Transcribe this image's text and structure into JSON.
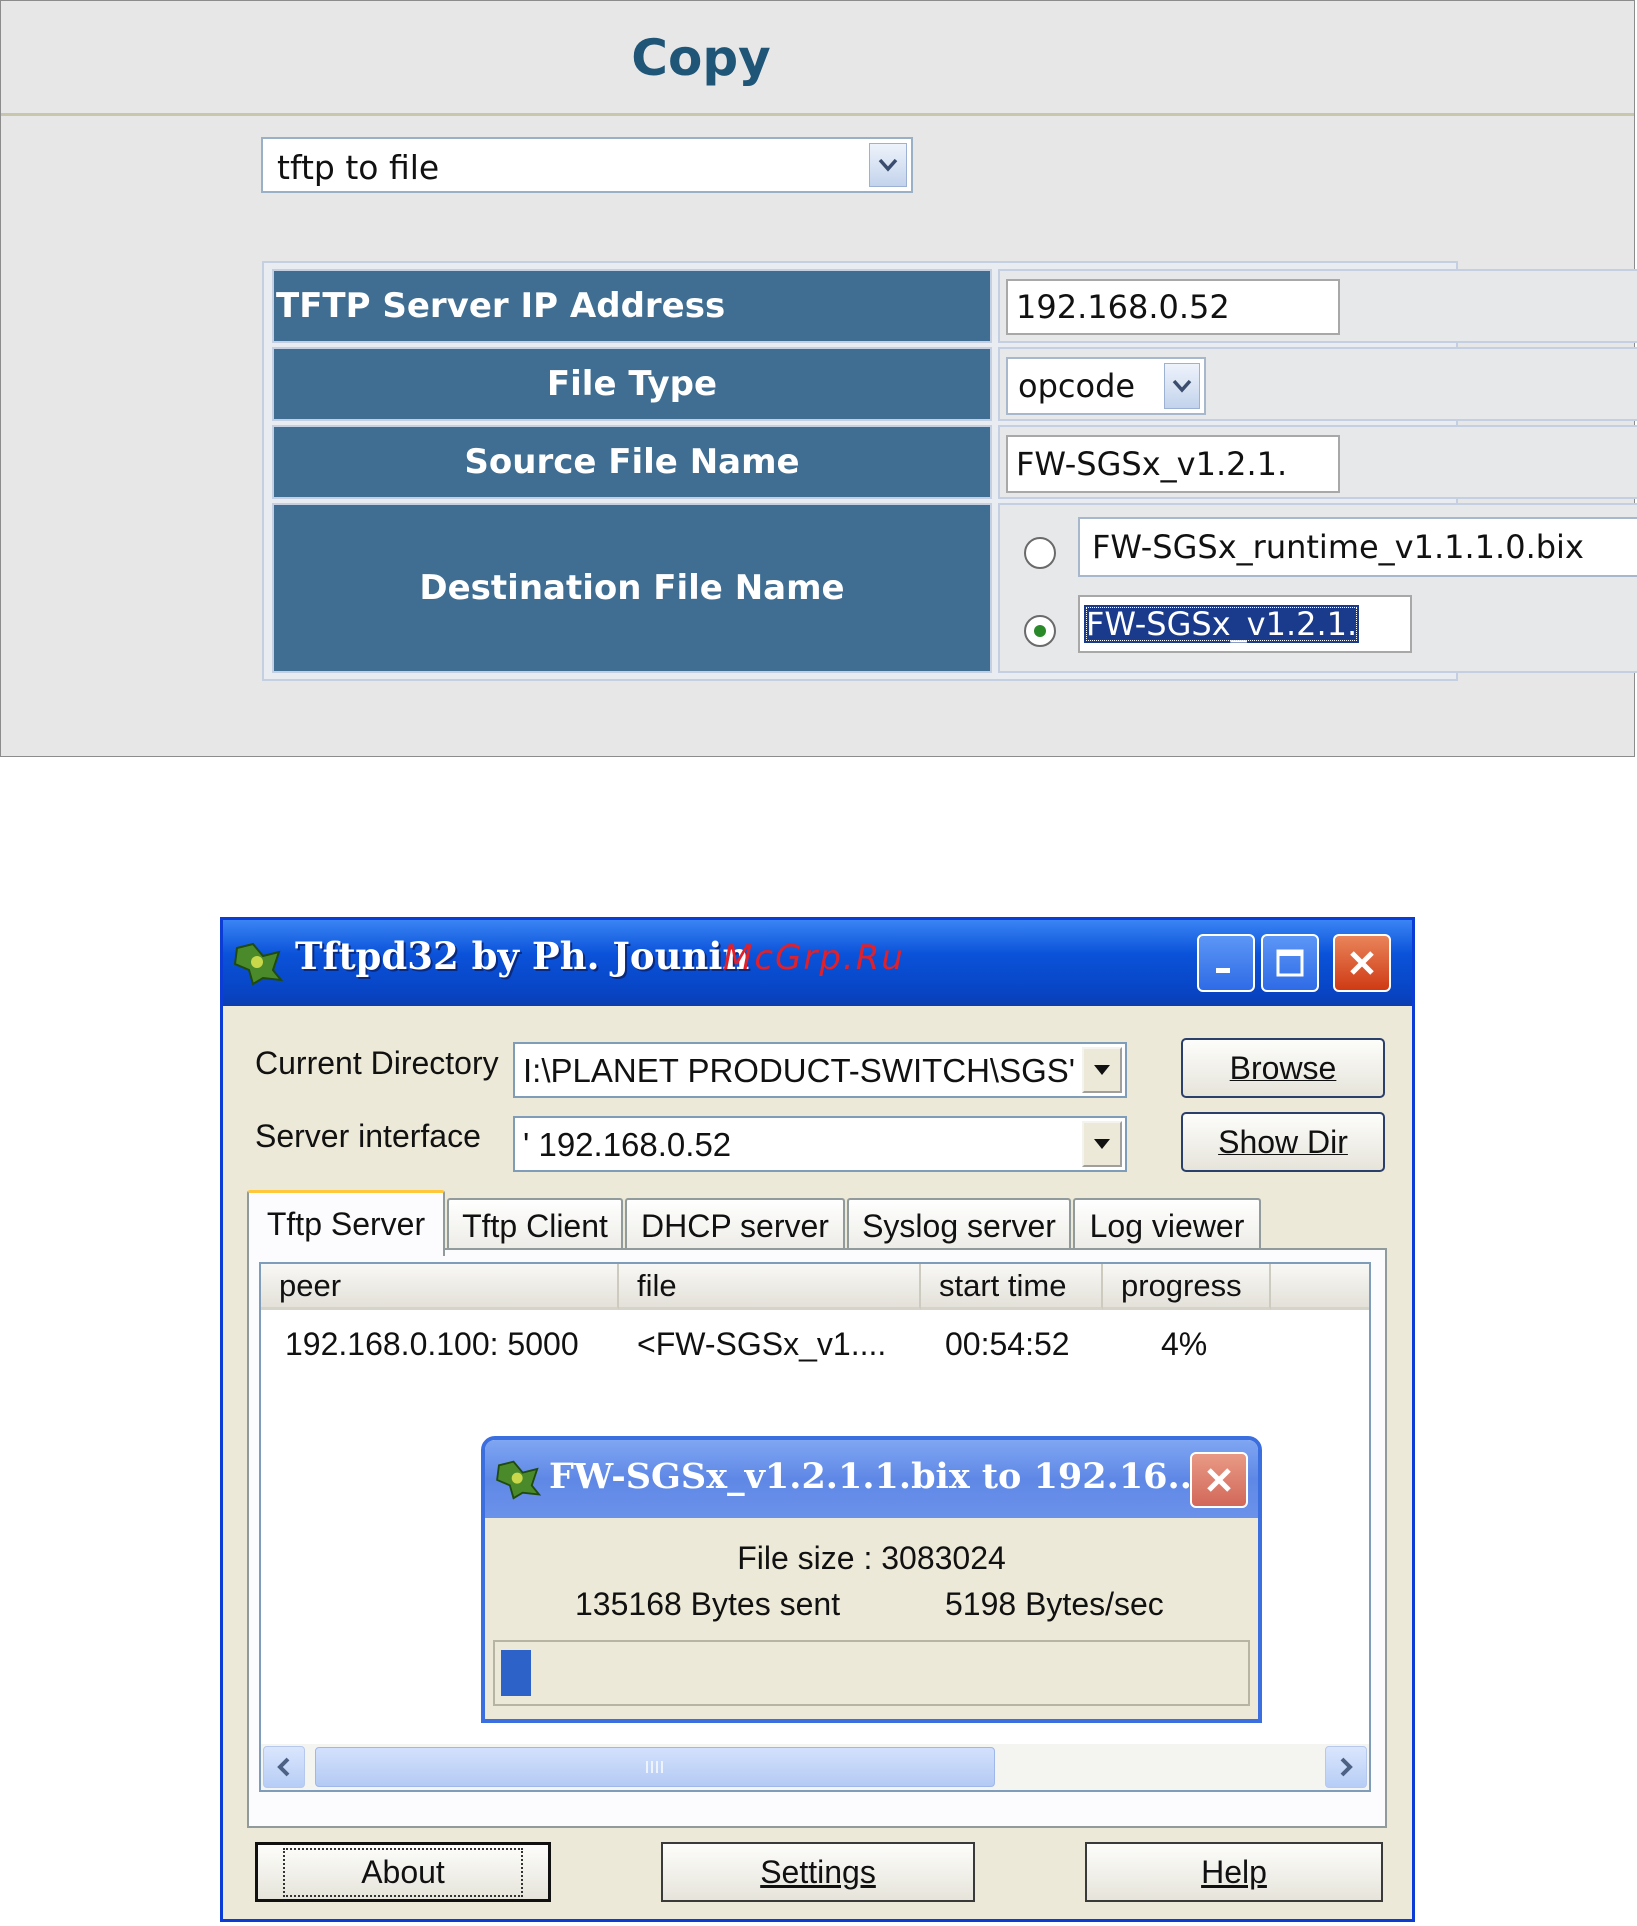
{
  "copy_panel": {
    "title": "Copy",
    "mode_select": "tftp  to  file",
    "rows": {
      "server_ip_label": "TFTP Server IP Address",
      "server_ip_value": "192.168.0.52",
      "file_type_label": "File Type",
      "file_type_value": "opcode",
      "source_label": "Source File Name",
      "source_value": "FW-SGSx_v1.2.1.",
      "dest_label": "Destination File Name",
      "dest_option1": "FW-SGSx_runtime_v1.1.1.0.bix",
      "dest_option2": "FW-SGSx_v1.2.1."
    }
  },
  "tftpd": {
    "title": "Tftpd32 by Ph. Jounin",
    "watermark": "McGrp.Ru",
    "current_dir_label": "Current Directory",
    "current_dir_value": "I:\\PLANET PRODUCT-SWITCH\\SGS'",
    "server_iface_label": "Server interface",
    "server_iface_value": "' 192.168.0.52",
    "browse_label": "Browse",
    "showdir_label": "Show Dir",
    "tabs": [
      "Tftp Server",
      "Tftp Client",
      "DHCP server",
      "Syslog server",
      "Log viewer"
    ],
    "columns": [
      "peer",
      "file",
      "start time",
      "progress"
    ],
    "row": {
      "peer": "192.168.0.100: 5000",
      "file": "<FW-SGSx_v1....",
      "start_time": "00:54:52",
      "progress": "4%"
    },
    "transfer_dialog": {
      "title": "FW-SGSx_v1.2.1.1.bix to 192.16...",
      "file_size": "File size : 3083024",
      "bytes_sent": "135168 Bytes sent",
      "rate": "5198 Bytes/sec",
      "progress_fraction": 0.04
    },
    "buttons": {
      "about": "About",
      "settings": "Settings",
      "help": "Help"
    }
  },
  "colors": {
    "header_blue": "#3f6e92",
    "title_blue": "#1f5577",
    "xp_title": "#0a52d9",
    "progress_fill": "#2d62c8",
    "watermark_red": "#e0202a"
  },
  "icons": [
    "chevron-down-icon",
    "minimize-icon",
    "maximize-icon",
    "close-icon",
    "app-icon",
    "scroll-left-icon",
    "scroll-right-icon"
  ]
}
